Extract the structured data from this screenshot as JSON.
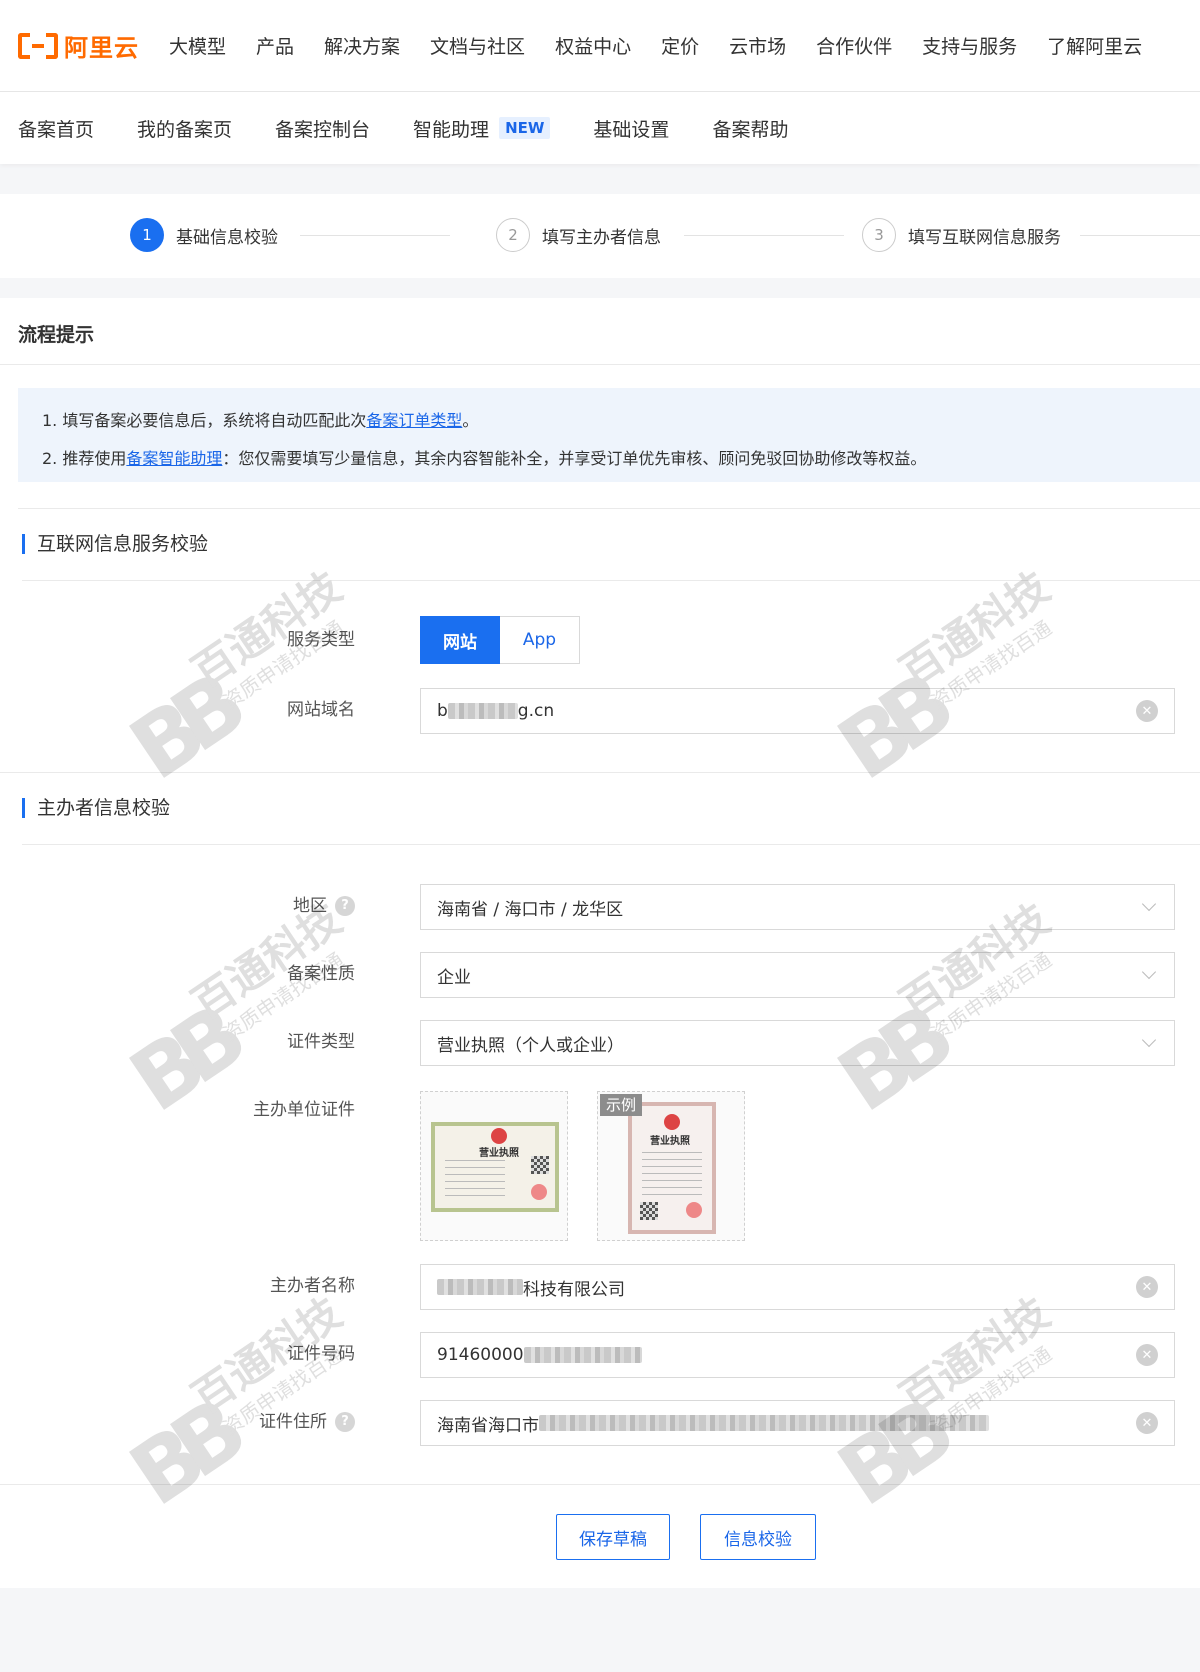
{
  "brand": {
    "logo_text": "阿里云"
  },
  "topnav": {
    "items": [
      "大模型",
      "产品",
      "解决方案",
      "文档与社区",
      "权益中心",
      "定价",
      "云市场",
      "合作伙伴",
      "支持与服务",
      "了解阿里云"
    ]
  },
  "subnav": {
    "items": [
      "备案首页",
      "我的备案页",
      "备案控制台",
      "智能助理",
      "基础设置",
      "备案帮助"
    ],
    "new_badge": "NEW"
  },
  "steps": [
    {
      "num": "1",
      "label": "基础信息校验",
      "active": true
    },
    {
      "num": "2",
      "label": "填写主办者信息",
      "active": false
    },
    {
      "num": "3",
      "label": "填写互联网信息服务",
      "active": false
    }
  ],
  "notice": {
    "title": "流程提示",
    "line1_pre": "1. 填写备案必要信息后，系统将自动匹配此次",
    "line1_link": "备案订单类型",
    "line1_post": "。",
    "line2_pre": "2. 推荐使用",
    "line2_link": "备案智能助理",
    "line2_post": "：您仅需要填写少量信息，其余内容智能补全，并享受订单优先审核、顾问免驳回协助修改等权益。"
  },
  "service_section": {
    "title": "互联网信息服务校验",
    "service_type_label": "服务类型",
    "service_type_options": [
      "网站",
      "App"
    ],
    "service_type_selected": "网站",
    "domain_label": "网站域名",
    "domain_prefix": "b",
    "domain_suffix": "g.cn"
  },
  "host_section": {
    "title": "主办者信息校验",
    "region_label": "地区",
    "region_value": "海南省 / 海口市 / 龙华区",
    "nature_label": "备案性质",
    "nature_value": "企业",
    "cert_type_label": "证件类型",
    "cert_type_value": "营业执照（个人或企业）",
    "cert_upload_label": "主办单位证件",
    "sample_tag": "示例",
    "license_title": "营业执照",
    "name_label": "主办者名称",
    "name_value_suffix": "科技有限公司",
    "cert_no_label": "证件号码",
    "cert_no_prefix": "91460000",
    "address_label": "证件住所",
    "address_prefix": "海南省海口市"
  },
  "actions": {
    "save_draft": "保存草稿",
    "verify": "信息校验"
  },
  "watermark": {
    "logo": "BB",
    "line1": "百通科技",
    "line2": "资质申请找百通"
  },
  "colors": {
    "brand_orange": "#ff6a00",
    "primary_blue": "#1a6ff0",
    "link_blue": "#1a66e8"
  }
}
